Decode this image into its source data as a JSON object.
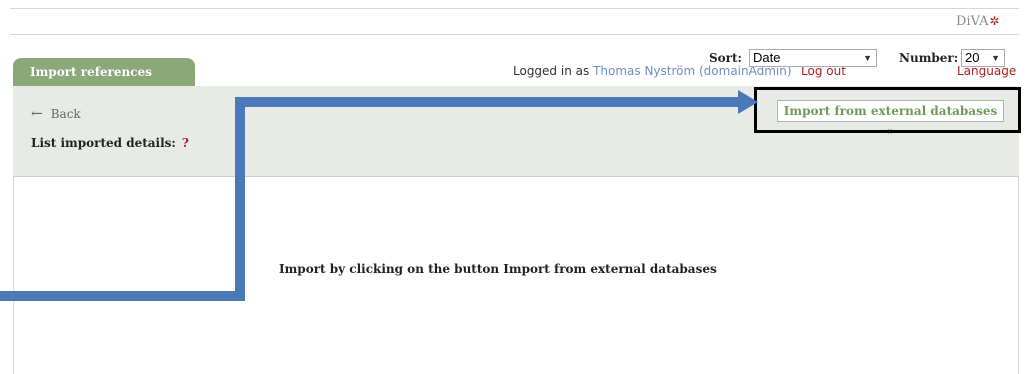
{
  "brand": {
    "logo_text": "DiVA",
    "logo_mark": "✲"
  },
  "tab": {
    "label": "Import references"
  },
  "user": {
    "logged_in_prefix": "Logged in as",
    "name": "Thomas Nyström (domainAdmin)",
    "logout_label": "Log out",
    "language_label": "Language"
  },
  "toolbar": {
    "back_label": "Back",
    "list_label": "List imported details:",
    "help_mark": "?",
    "import_button_label": "Import from external databases »",
    "sort_label": "Sort:",
    "sort_value": "Date",
    "number_label": "Number:",
    "number_value": "20"
  },
  "main": {
    "message": "Import by clicking on the button Import from external databases"
  },
  "colors": {
    "tab_green": "#8aa878",
    "toolbar_bg": "#e8ebe5",
    "link_red": "#b02020",
    "link_blue": "#6b8fc0",
    "annotation_arrow": "#4a78b8"
  }
}
